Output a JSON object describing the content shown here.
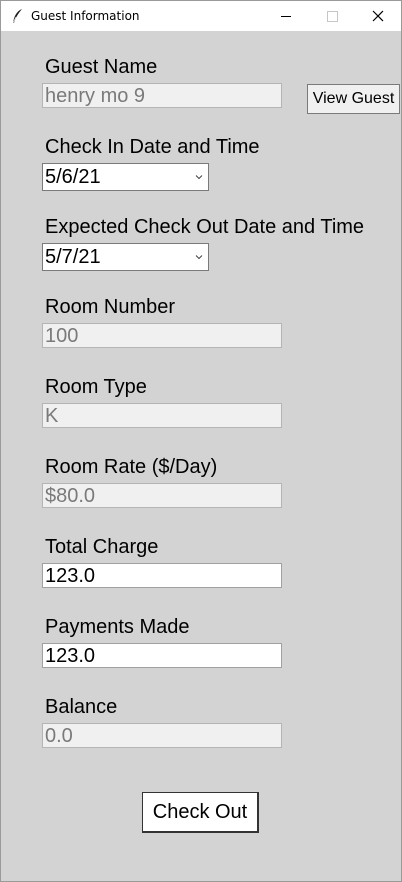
{
  "window": {
    "title": "Guest Information"
  },
  "guest_name": {
    "label": "Guest Name",
    "value": "henry mo 9",
    "button_label": "View Guest"
  },
  "check_in": {
    "label": "Check In Date and Time",
    "value": "5/6/21"
  },
  "check_out": {
    "label": "Expected Check Out Date and Time",
    "value": "5/7/21"
  },
  "room_number": {
    "label": "Room Number",
    "value": "100"
  },
  "room_type": {
    "label": "Room Type",
    "value": "K"
  },
  "room_rate": {
    "label": "Room Rate ($/Day)",
    "value": "$80.0"
  },
  "total_charge": {
    "label": "Total Charge",
    "value": "123.0"
  },
  "payments_made": {
    "label": "Payments Made",
    "value": "123.0"
  },
  "balance": {
    "label": "Balance",
    "value": "0.0"
  },
  "actions": {
    "checkout_label": "Check Out"
  },
  "icons": {
    "app": "feather-icon",
    "minimize": "minimize-icon",
    "maximize": "maximize-icon",
    "close": "close-icon",
    "dropdown": "chevron-down-icon"
  }
}
